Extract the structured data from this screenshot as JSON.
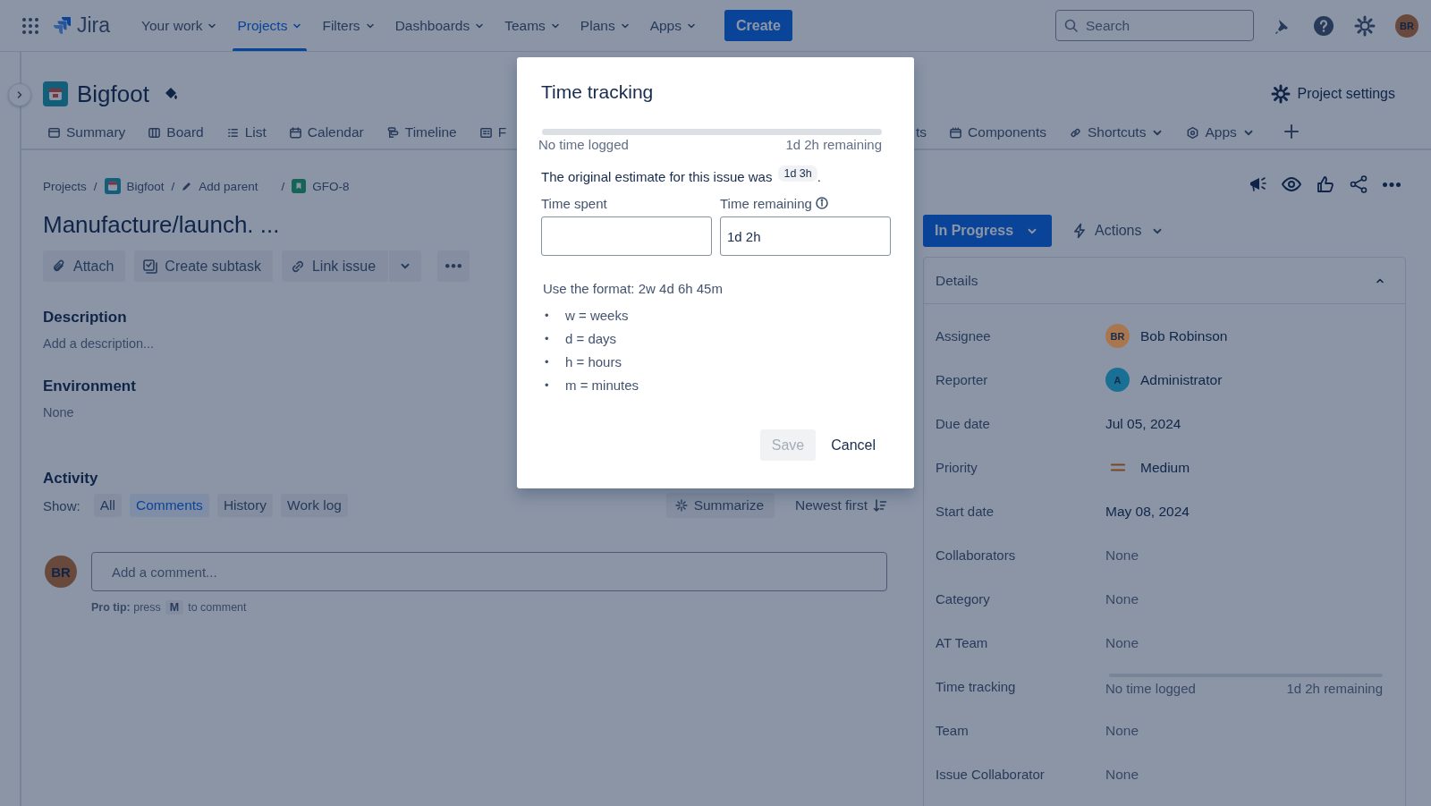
{
  "top_nav": {
    "product": "Jira",
    "items": [
      {
        "label": "Your work",
        "selected": false
      },
      {
        "label": "Projects",
        "selected": true
      },
      {
        "label": "Filters",
        "selected": false
      },
      {
        "label": "Dashboards",
        "selected": false
      },
      {
        "label": "Teams",
        "selected": false
      },
      {
        "label": "Plans",
        "selected": false
      },
      {
        "label": "Apps",
        "selected": false
      }
    ],
    "create_button": "Create",
    "search": {
      "placeholder": "Search"
    },
    "avatar": "BR"
  },
  "project": {
    "name": "Bigfoot",
    "settings": "Project settings",
    "tabs": [
      {
        "label": "Summary",
        "dropdown": false
      },
      {
        "label": "Board",
        "dropdown": false
      },
      {
        "label": "List",
        "dropdown": false
      },
      {
        "label": "Calendar",
        "dropdown": false
      },
      {
        "label": "Timeline",
        "dropdown": false
      },
      {
        "label": "F",
        "dropdown": false
      },
      {
        "label": "ts",
        "dropdown": false
      },
      {
        "label": "Components",
        "dropdown": false
      },
      {
        "label": "Shortcuts",
        "dropdown": true
      },
      {
        "label": "Apps",
        "dropdown": true
      }
    ]
  },
  "issue": {
    "breadcrumbs": [
      "Projects",
      "Bigfoot",
      "Add parent",
      "GFO-8"
    ],
    "separators": [
      "/",
      "/",
      "/"
    ],
    "title": "Manufacture/launch. ...",
    "actions": [
      "Attach",
      "Create subtask",
      "Link issue"
    ],
    "sections": [
      {
        "heading": "Description",
        "text": "Add a description..."
      },
      {
        "heading": "Environment",
        "text": "None"
      }
    ],
    "activity": {
      "heading": "Activity",
      "show_label": "Show:",
      "filters": [
        {
          "label": "All",
          "selected": false
        },
        {
          "label": "Comments",
          "selected": true
        },
        {
          "label": "History",
          "selected": false
        },
        {
          "label": "Work log",
          "selected": false
        }
      ],
      "summarize": "Summarize",
      "sort": "Newest first"
    },
    "comment": {
      "avatar": "BR",
      "placeholder": "Add a comment...",
      "tip": "**Pro tip:** press",
      "key": "M",
      "tip_end": "to comment"
    }
  },
  "side": {
    "status": "In Progress",
    "actions": "Actions",
    "details": {
      "title": "Details",
      "expanded": true,
      "rows": [
        {
          "label": "Assignee",
          "kind": "user",
          "avatar": "BR",
          "color": "#a8774f",
          "value": "Bob Robinson"
        },
        {
          "label": "Reporter",
          "kind": "user",
          "avatar": "A",
          "color": "#1a6f95",
          "value": "Administrator"
        },
        {
          "label": "Due date",
          "kind": "text",
          "value": "Jul 05, 2024"
        },
        {
          "label": "Priority",
          "kind": "priority",
          "value": "Medium"
        },
        {
          "label": "Start date",
          "kind": "text",
          "value": "May 08, 2024"
        },
        {
          "label": "Collaborators",
          "kind": "empty",
          "value": "None"
        },
        {
          "label": "Category",
          "kind": "empty",
          "value": "None"
        },
        {
          "label": "AT Team",
          "kind": "empty",
          "value": "None"
        },
        {
          "label": "Time tracking",
          "kind": "tracking",
          "level": 0,
          "logged": "No time logged",
          "remaining": "1d 2h remaining"
        },
        {
          "label": "Team",
          "kind": "empty",
          "value": "None"
        },
        {
          "label": "Issue Collaborator",
          "kind": "empty",
          "value": "None"
        }
      ]
    }
  },
  "modal": {
    "title": "Time tracking",
    "level": 0,
    "logged": "No time logged",
    "remaining": "1d 2h remaining",
    "estimate_text": "The original estimate for this issue was",
    "estimate": "1d 3h",
    "estimate_end": ".",
    "fields": [
      {
        "label": "Time spent",
        "info": false
      },
      {
        "label": "Time remaining",
        "info": true,
        "value": "1d 2h"
      }
    ],
    "help": "Use the format: 2w 4d 6h 45m",
    "units": [
      {
        "bullet": "•",
        "text": "w = weeks"
      },
      {
        "bullet": "•",
        "text": "d = days"
      },
      {
        "bullet": "•",
        "text": "h = hours"
      },
      {
        "bullet": "•",
        "text": "m = minutes"
      }
    ],
    "save": {
      "label": "Save",
      "disabled": true
    },
    "cancel": "Cancel"
  }
}
